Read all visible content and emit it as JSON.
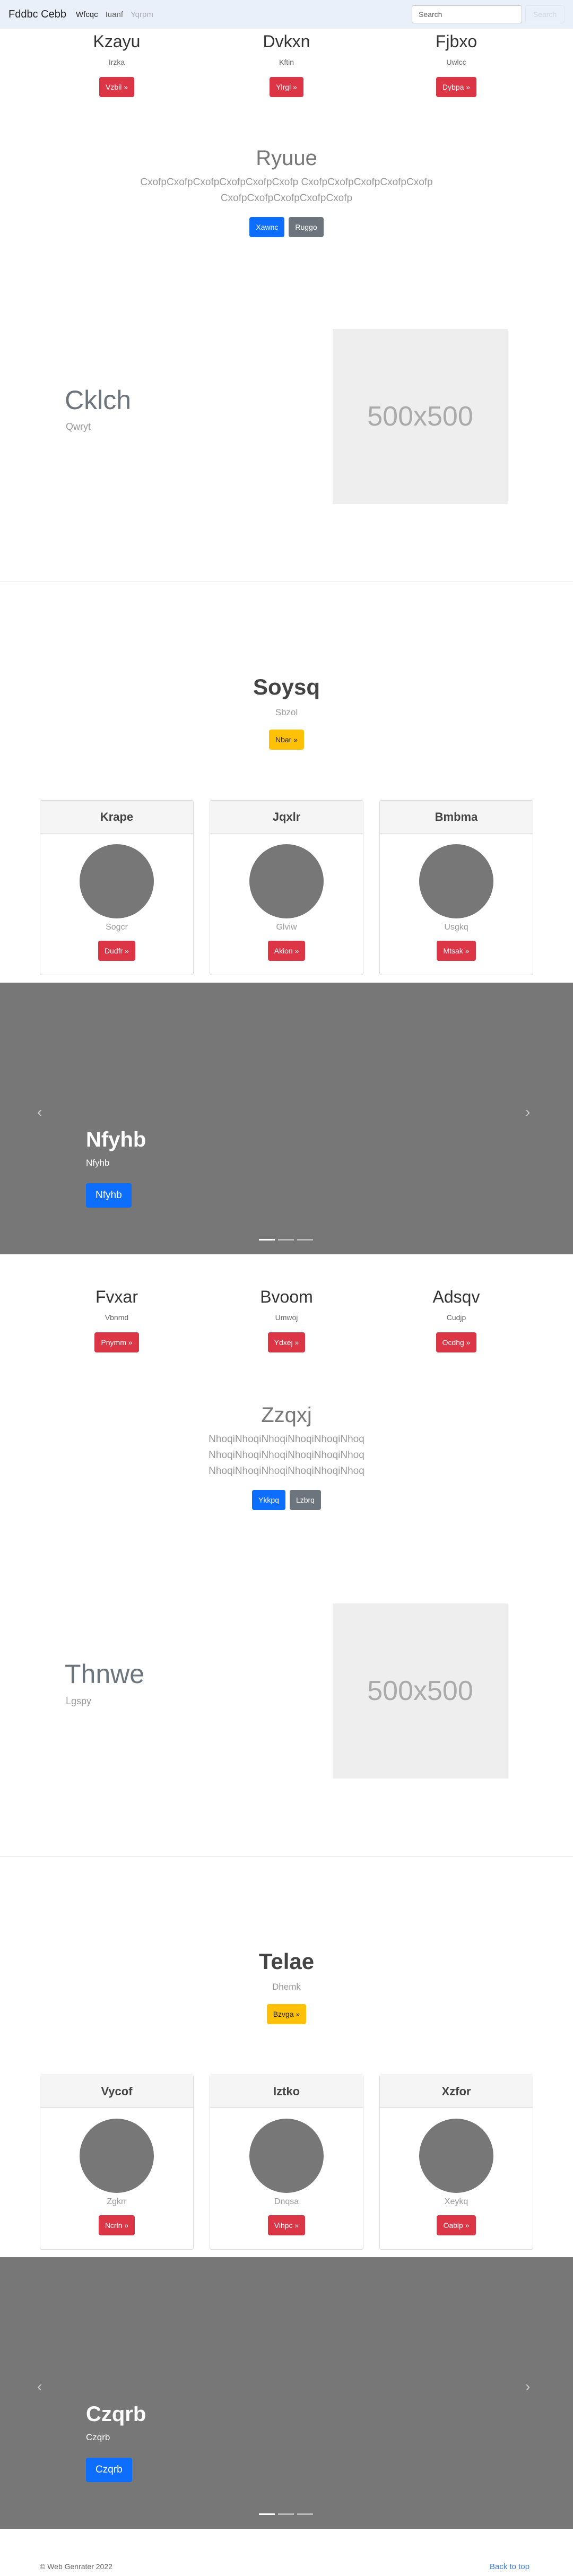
{
  "navbar": {
    "brand": "Fddbc Cebb",
    "links": [
      {
        "label": "Wfcqc"
      },
      {
        "label": "Iuanf"
      },
      {
        "label": "Yqrpm"
      }
    ],
    "search_placeholder": "Search",
    "search_button": "Search"
  },
  "row1": [
    {
      "title": "Kzayu",
      "text": "Irzka",
      "button": "Vzbil »"
    },
    {
      "title": "Dvkxn",
      "text": "Kftin",
      "button": "Ylrgl »"
    },
    {
      "title": "Fjbxo",
      "text": "Uwlcc",
      "button": "Dybpa »"
    }
  ],
  "jumbo1": {
    "title": "Ryuue",
    "lead": "CxofpCxofpCxofpCxofpCxofpCxofp CxofpCxofpCxofpCxofpCxofp CxofpCxofpCxofpCxofpCxofp",
    "primary_button": "Xawnc",
    "secondary_button": "Ruggo"
  },
  "feature1": {
    "title": "Cklch",
    "subtitle": "Qwryt",
    "image_label": "500x500"
  },
  "section1": {
    "title": "Soysq",
    "subtitle": "Sbzol",
    "button": "Nbar »"
  },
  "cards1": [
    {
      "header": "Krape",
      "text": "Sogcr",
      "button": "Dudfr »"
    },
    {
      "header": "Jqxlr",
      "text": "Glviw",
      "button": "Akion »"
    },
    {
      "header": "Bmbma",
      "text": "Usgkq",
      "button": "Mtsak »"
    }
  ],
  "carousel1": {
    "title": "Nfyhb",
    "caption": "Nfyhb",
    "button": "Nfyhb",
    "prev": "‹",
    "next": "›"
  },
  "row2": [
    {
      "title": "Fvxar",
      "text": "Vbnmd",
      "button": "Pnymm »"
    },
    {
      "title": "Bvoom",
      "text": "Umwoj",
      "button": "Ydxej »"
    },
    {
      "title": "Adsqv",
      "text": "Cudjp",
      "button": "Ocdhg »"
    }
  ],
  "jumbo2": {
    "title": "Zzqxj",
    "lead": "NhoqiNhoqiNhoqiNhoqiNhoqiNhoq NhoqiNhoqiNhoqiNhoqiNhoqiNhoq NhoqiNhoqiNhoqiNhoqiNhoqiNhoq",
    "primary_button": "Ykkpq",
    "secondary_button": "Lzbrq"
  },
  "feature2": {
    "title": "Thnwe",
    "subtitle": "Lgspy",
    "image_label": "500x500"
  },
  "section2": {
    "title": "Telae",
    "subtitle": "Dhemk",
    "button": "Bzvga »"
  },
  "cards2": [
    {
      "header": "Vycof",
      "text": "Zgkrr",
      "button": "Ncrln »"
    },
    {
      "header": "Iztko",
      "text": "Dnqsa",
      "button": "Vihpc »"
    },
    {
      "header": "Xzfor",
      "text": "Xeykq",
      "button": "Oablp »"
    }
  ],
  "carousel2": {
    "title": "Czqrb",
    "caption": "Czqrb",
    "button": "Czqrb",
    "prev": "‹",
    "next": "›"
  },
  "footer": {
    "copyright": "© Web Genrater 2022",
    "back_to_top": "Back to top"
  },
  "colors": {
    "danger": "#dc3545",
    "primary": "#0d6efd",
    "secondary": "#6c757d",
    "warning": "#ffc107",
    "carousel_bg": "#777777"
  }
}
